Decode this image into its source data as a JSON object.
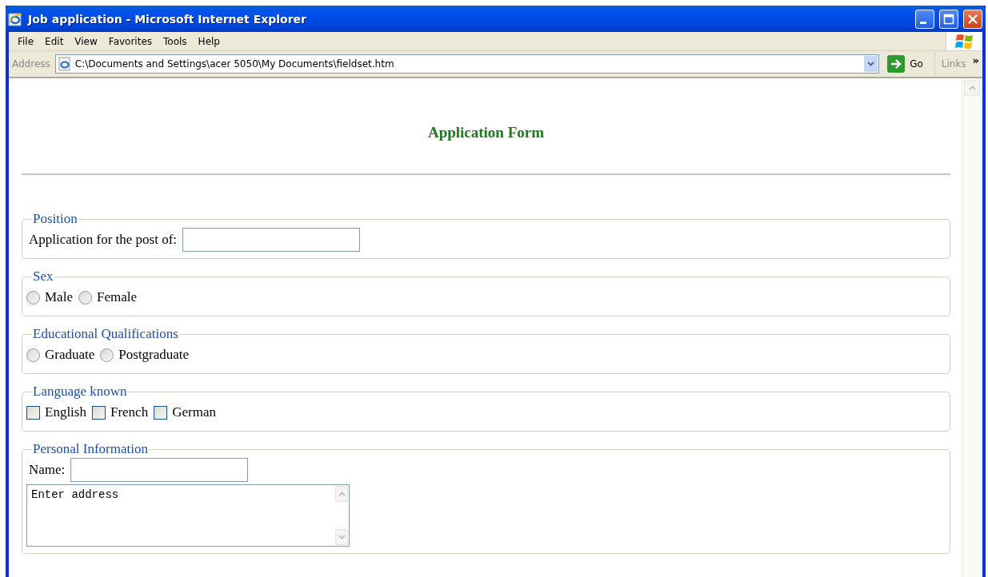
{
  "window": {
    "title": "Job application - Microsoft Internet Explorer"
  },
  "menu": [
    "File",
    "Edit",
    "View",
    "Favorites",
    "Tools",
    "Help"
  ],
  "address_bar": {
    "label": "Address",
    "value": "C:\\Documents and Settings\\acer 5050\\My Documents\\fieldset.htm",
    "go": "Go",
    "links": "Links",
    "more": "»"
  },
  "page": {
    "heading": "Application Form",
    "fieldsets": [
      {
        "legend": "Position",
        "controls": [
          {
            "kind": "text",
            "label": "Application for the post of:"
          }
        ]
      },
      {
        "legend": "Sex",
        "controls": [
          {
            "kind": "radio",
            "label": "Male",
            "selected": false
          },
          {
            "kind": "radio",
            "label": "Female",
            "selected": false
          }
        ]
      },
      {
        "legend": "Educational Qualifications",
        "controls": [
          {
            "kind": "radio",
            "label": "Graduate",
            "selected": false
          },
          {
            "kind": "radio",
            "label": "Postgraduate",
            "selected": false
          }
        ]
      },
      {
        "legend": "Language known",
        "controls": [
          {
            "kind": "checkbox",
            "label": "English",
            "checked": false
          },
          {
            "kind": "checkbox",
            "label": "French",
            "checked": false
          },
          {
            "kind": "checkbox",
            "label": "German",
            "checked": false
          }
        ]
      },
      {
        "legend": "Personal Information",
        "controls": [
          {
            "kind": "text",
            "label": "Name:"
          },
          {
            "kind": "textarea",
            "value": "Enter address"
          }
        ]
      }
    ]
  }
}
